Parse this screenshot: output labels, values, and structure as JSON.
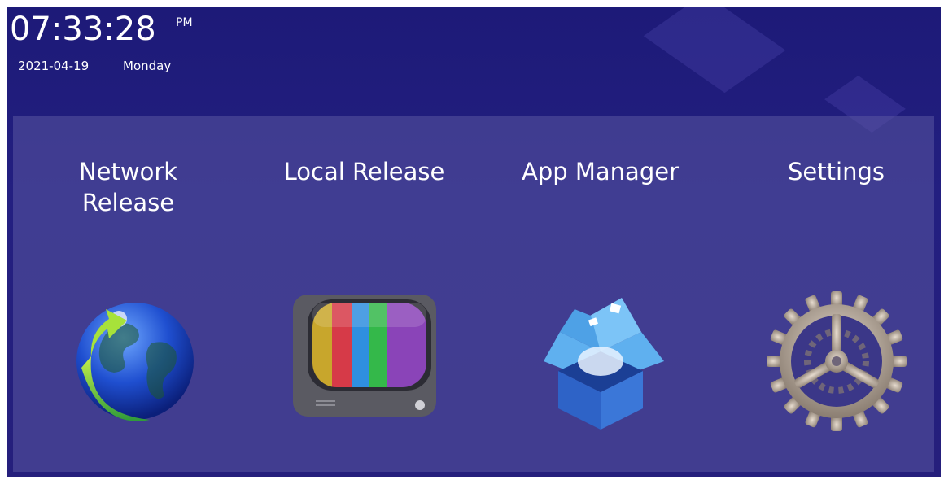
{
  "status": {
    "time": "07:33:28",
    "ampm": "PM",
    "date": "2021-04-19",
    "weekday": "Monday"
  },
  "menu": [
    {
      "label": "Network\nRelease",
      "icon": "globe-refresh-icon"
    },
    {
      "label": "Local Release",
      "icon": "tv-icon"
    },
    {
      "label": "App Manager",
      "icon": "open-box-icon"
    },
    {
      "label": "Settings",
      "icon": "gear-icon"
    }
  ],
  "colors": {
    "background": "#211d7c",
    "panel": "#3b3788",
    "text": "#ffffff"
  }
}
